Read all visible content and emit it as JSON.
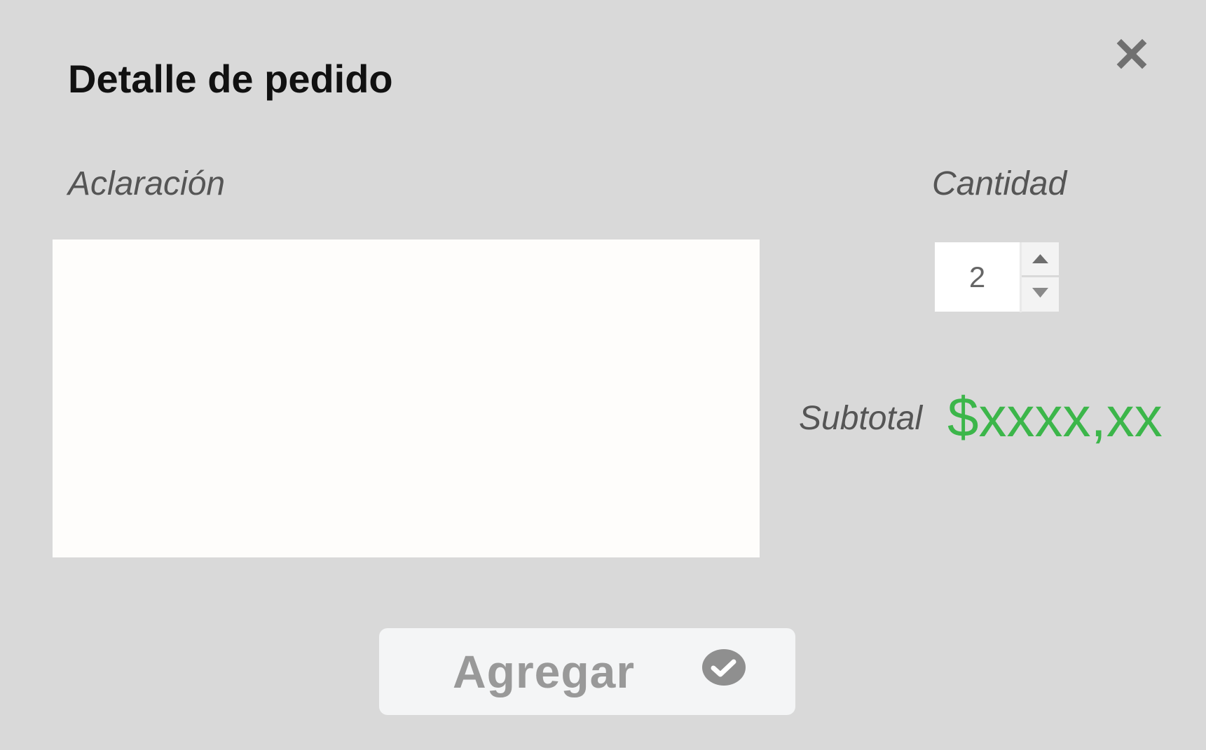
{
  "dialog": {
    "title": "Detalle de pedido",
    "close_icon": "close-icon"
  },
  "aclaracion": {
    "label": "Aclaración",
    "value": ""
  },
  "cantidad": {
    "label": "Cantidad",
    "value": "2",
    "up_icon": "triangle-up-icon",
    "down_icon": "triangle-down-icon"
  },
  "subtotal": {
    "label": "Subtotal",
    "value": "$xxxx,xx"
  },
  "add_button": {
    "label": "Agregar",
    "icon": "check-circle-icon"
  },
  "colors": {
    "background": "#d9d9d9",
    "subtotal": "#3cb64a",
    "button_text": "#999999",
    "icon_gray": "#707070"
  }
}
